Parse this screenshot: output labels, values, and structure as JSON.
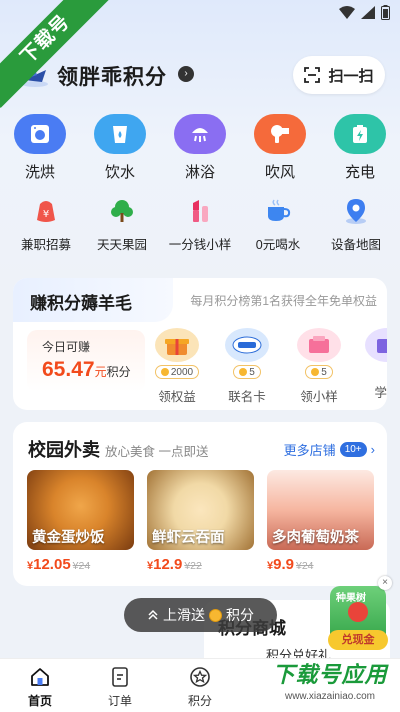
{
  "watermark": {
    "corner": "下载号",
    "bottom": "下载号应用",
    "bottom_url": "www.xiazainiao.com"
  },
  "header": {
    "title": "领胖乖积分",
    "arrow": "›",
    "scan_label": "扫一扫"
  },
  "services": [
    {
      "label": "洗烘",
      "color": "#4a7cf3"
    },
    {
      "label": "饮水",
      "color": "#3fa6f0"
    },
    {
      "label": "淋浴",
      "color": "#8a6ef2"
    },
    {
      "label": "吹风",
      "color": "#f56a3b"
    },
    {
      "label": "充电",
      "color": "#2ec4a8"
    }
  ],
  "tools": [
    {
      "label": "兼职招募",
      "icon": "bag-icon"
    },
    {
      "label": "天天果园",
      "icon": "tree-icon"
    },
    {
      "label": "一分钱小样",
      "icon": "lipstick-icon"
    },
    {
      "label": "0元喝水",
      "icon": "cup-icon"
    },
    {
      "label": "设备地图",
      "icon": "map-pin-icon"
    }
  ],
  "earn": {
    "title": "赚积分薅羊毛",
    "subtitle": "每月积分榜第1名获得全年免单权益",
    "today_label": "今日可赚",
    "today_value": "65.47",
    "today_unit_yuan": "元",
    "today_unit_points": "积分",
    "rewards": [
      {
        "label": "领权益",
        "points": "2000",
        "color": "#f7c66a"
      },
      {
        "label": "联名卡",
        "points": "5",
        "color": "#cfe4ff"
      },
      {
        "label": "领小样",
        "points": "5",
        "color": "#ffd3de"
      },
      {
        "label": "学生",
        "points": "",
        "color": "#e3d9ff"
      }
    ]
  },
  "food": {
    "title": "校园外卖",
    "subtitle": "放心美食 一点即送",
    "more_label": "更多店铺",
    "more_badge": "10+",
    "dishes": [
      {
        "name": "黄金蛋炒饭",
        "currency": "¥",
        "price": "12.05",
        "old_price": "¥24",
        "color1": "#d9842b",
        "color2": "#7a3b10"
      },
      {
        "name": "鲜虾云吞面",
        "currency": "¥",
        "price": "12.9",
        "old_price": "¥22",
        "color1": "#f1d9a6",
        "color2": "#a27336"
      },
      {
        "name": "多肉葡萄奶茶",
        "currency": "¥",
        "price": "9.9",
        "old_price": "¥24",
        "color1": "#f6b6a0",
        "color2": "#c96a56"
      }
    ]
  },
  "toast": {
    "text_before": "上滑送",
    "text_after": "积分"
  },
  "mall": {
    "title": "积分商城",
    "subtitle": "积分兑好礼"
  },
  "float_ad": {
    "tag": "种果树",
    "cash": "兑现金"
  },
  "tabs": [
    {
      "label": "首页",
      "icon": "home-icon",
      "active": true
    },
    {
      "label": "订单",
      "icon": "order-icon",
      "active": false
    },
    {
      "label": "积分",
      "icon": "star-icon",
      "active": false
    }
  ]
}
